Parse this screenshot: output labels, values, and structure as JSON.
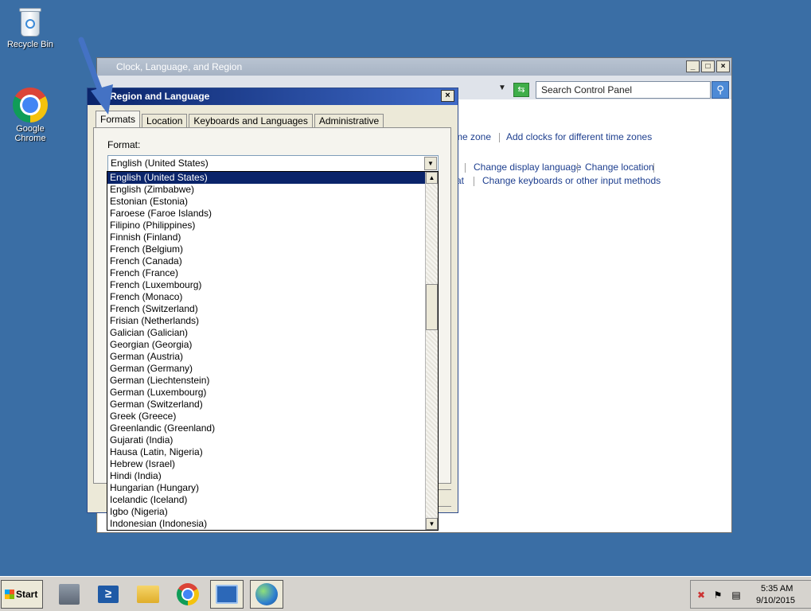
{
  "desktop": {
    "recycle_bin_label": "Recycle Bin",
    "chrome_label": "Google Chrome"
  },
  "control_panel": {
    "title": "Clock, Language, and Region",
    "search_placeholder": "Search Control Panel",
    "links": {
      "time_zone_fragment": "me zone",
      "add_clocks": "Add clocks for different time zones",
      "change_display_language": "Change display language",
      "change_location": "Change location",
      "format_fragment": "at",
      "change_keyboards": "Change keyboards or other input methods"
    }
  },
  "region_dialog": {
    "title": "Region and Language",
    "tabs": [
      "Formats",
      "Location",
      "Keyboards and Languages",
      "Administrative"
    ],
    "format_label": "Format:",
    "format_value": "English (United States)",
    "options": [
      "English (United States)",
      "English (Zimbabwe)",
      "Estonian (Estonia)",
      "Faroese (Faroe Islands)",
      "Filipino (Philippines)",
      "Finnish (Finland)",
      "French (Belgium)",
      "French (Canada)",
      "French (France)",
      "French (Luxembourg)",
      "French (Monaco)",
      "French (Switzerland)",
      "Frisian (Netherlands)",
      "Galician (Galician)",
      "Georgian (Georgia)",
      "German (Austria)",
      "German (Germany)",
      "German (Liechtenstein)",
      "German (Luxembourg)",
      "German (Switzerland)",
      "Greek (Greece)",
      "Greenlandic (Greenland)",
      "Gujarati (India)",
      "Hausa (Latin, Nigeria)",
      "Hebrew (Israel)",
      "Hindi (India)",
      "Hungarian (Hungary)",
      "Icelandic (Iceland)",
      "Igbo (Nigeria)",
      "Indonesian (Indonesia)"
    ],
    "selected_index": 0
  },
  "taskbar": {
    "start_label": "Start",
    "clock_time": "5:35 AM",
    "clock_date": "9/10/2015"
  }
}
